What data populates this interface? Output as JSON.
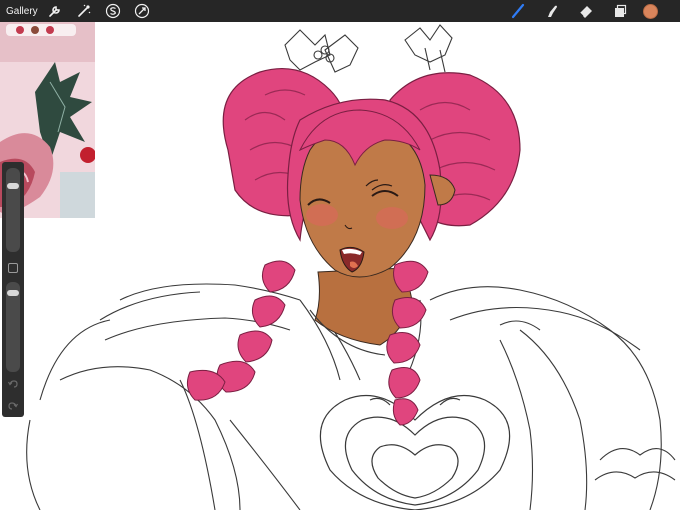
{
  "app": {
    "gallery_label": "Gallery"
  },
  "toolbar": {
    "left_icons": [
      "wrench-icon",
      "magic-wand-icon",
      "selection-s-icon",
      "transform-arrow-icon"
    ],
    "right_icons": [
      "brush-icon",
      "smudge-icon",
      "eraser-icon",
      "layers-icon"
    ],
    "current_color": "#d9855c"
  },
  "sidebar": {
    "brush_size_level": 0.15,
    "opacity_level": 0.05
  },
  "colors": {
    "toolbar_bg": "#262626",
    "accent_blue": "#2f7cf6",
    "hair_pink": "#e0457e",
    "skin": "#c07a48",
    "blush": "#d96a5a"
  }
}
